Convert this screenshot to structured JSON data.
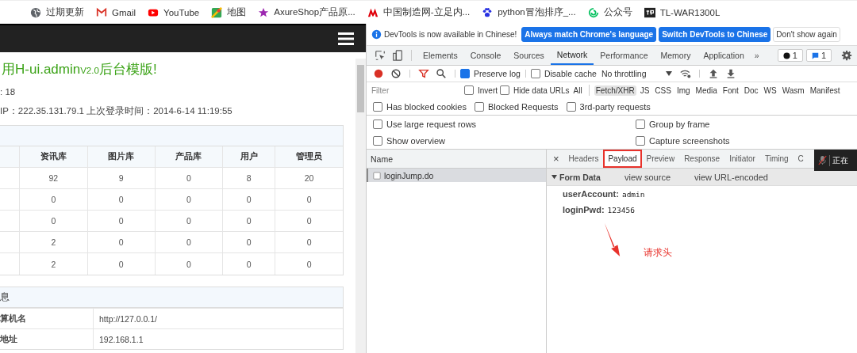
{
  "bookmarks": [
    {
      "label": "过期更新"
    },
    {
      "label": "Gmail"
    },
    {
      "label": "YouTube"
    },
    {
      "label": "地图"
    },
    {
      "label": "AxureShop产品原..."
    },
    {
      "label": "中国制造网-立足内..."
    },
    {
      "label": "python冒泡排序_..."
    },
    {
      "label": "公众号"
    },
    {
      "label": "TL-WAR1300L"
    }
  ],
  "page": {
    "title": "用H-ui.admin",
    "version": "V2.0",
    "title_rest": "后台模版!",
    "count_line": ": 18",
    "login_line": "IP：222.35.131.79.1 上次登录时间：2014-6-14 11:19:55",
    "stats_table": {
      "columns": [
        "资讯库",
        "图片库",
        "产品库",
        "用户",
        "管理员"
      ],
      "rows": [
        [
          "92",
          "9",
          "0",
          "8",
          "20"
        ],
        [
          "0",
          "0",
          "0",
          "0",
          "0"
        ],
        [
          "0",
          "0",
          "0",
          "0",
          "0"
        ],
        [
          "2",
          "0",
          "0",
          "0",
          "0"
        ],
        [
          "2",
          "0",
          "0",
          "0",
          "0"
        ]
      ]
    },
    "info_panel": {
      "title": "息",
      "rows": [
        {
          "label": "算机名",
          "value": "http://127.0.0.1/"
        },
        {
          "label": "地址",
          "value": "192.168.1.1"
        }
      ]
    }
  },
  "devtools": {
    "infobar": {
      "message": "DevTools is now available in Chinese!",
      "buttons": [
        {
          "label": "Always match Chrome's language",
          "primary": true
        },
        {
          "label": "Switch DevTools to Chinese",
          "primary": true
        },
        {
          "label": "Don't show again",
          "primary": false
        }
      ]
    },
    "tabs": [
      {
        "label": "Elements",
        "selected": false
      },
      {
        "label": "Console",
        "selected": false
      },
      {
        "label": "Sources",
        "selected": false
      },
      {
        "label": "Network",
        "selected": true
      },
      {
        "label": "Performance",
        "selected": false
      },
      {
        "label": "Memory",
        "selected": false
      },
      {
        "label": "Application",
        "selected": false
      }
    ],
    "more_tabs": "»",
    "error_count": "1",
    "message_count": "1",
    "preserve_log": {
      "label": "Preserve log",
      "checked": true
    },
    "disable_cache": {
      "label": "Disable cache",
      "checked": false
    },
    "throttling": "No throttling",
    "filter": {
      "placeholder": "Filter"
    },
    "filter_options": [
      {
        "label": "Invert",
        "checked": false
      },
      {
        "label": "Hide data URLs",
        "checked": false
      }
    ],
    "types": [
      {
        "label": "All",
        "selected": false
      },
      {
        "label": "Fetch/XHR",
        "selected": true
      },
      {
        "label": "JS",
        "selected": false
      },
      {
        "label": "CSS",
        "selected": false
      },
      {
        "label": "Img",
        "selected": false
      },
      {
        "label": "Media",
        "selected": false
      },
      {
        "label": "Font",
        "selected": false
      },
      {
        "label": "Doc",
        "selected": false
      },
      {
        "label": "WS",
        "selected": false
      },
      {
        "label": "Wasm",
        "selected": false
      },
      {
        "label": "Manifest",
        "selected": false
      }
    ],
    "request_filters": [
      {
        "label": "Has blocked cookies",
        "checked": false
      },
      {
        "label": "Blocked Requests",
        "checked": false
      },
      {
        "label": "3rd-party requests",
        "checked": false
      }
    ],
    "settings": [
      {
        "label": "Use large request rows",
        "checked": false
      },
      {
        "label": "Group by frame",
        "checked": false
      },
      {
        "label": "Show overview",
        "checked": false
      },
      {
        "label": "Capture screenshots",
        "checked": false
      }
    ],
    "requests": {
      "header": "Name",
      "rows": [
        {
          "name": "loginJump.do",
          "selected": true
        }
      ]
    },
    "close": "×",
    "detail_tabs": [
      {
        "label": "Headers",
        "selected": false,
        "highlighted": false
      },
      {
        "label": "Payload",
        "selected": true,
        "highlighted": true
      },
      {
        "label": "Preview",
        "selected": false,
        "highlighted": false
      },
      {
        "label": "Response",
        "selected": false,
        "highlighted": false
      },
      {
        "label": "Initiator",
        "selected": false,
        "highlighted": false
      },
      {
        "label": "Timing",
        "selected": false,
        "highlighted": false
      },
      {
        "label": "C",
        "selected": false,
        "highlighted": false
      }
    ],
    "form_data": {
      "title": "Form Data",
      "expanded": true,
      "links": [
        "view source",
        "view URL-encoded"
      ],
      "fields": [
        {
          "key": "userAccount:",
          "value": "admin"
        },
        {
          "key": "loginPwd:",
          "value": "123456"
        }
      ]
    },
    "annotation": "请求头",
    "overlay": "正在"
  }
}
